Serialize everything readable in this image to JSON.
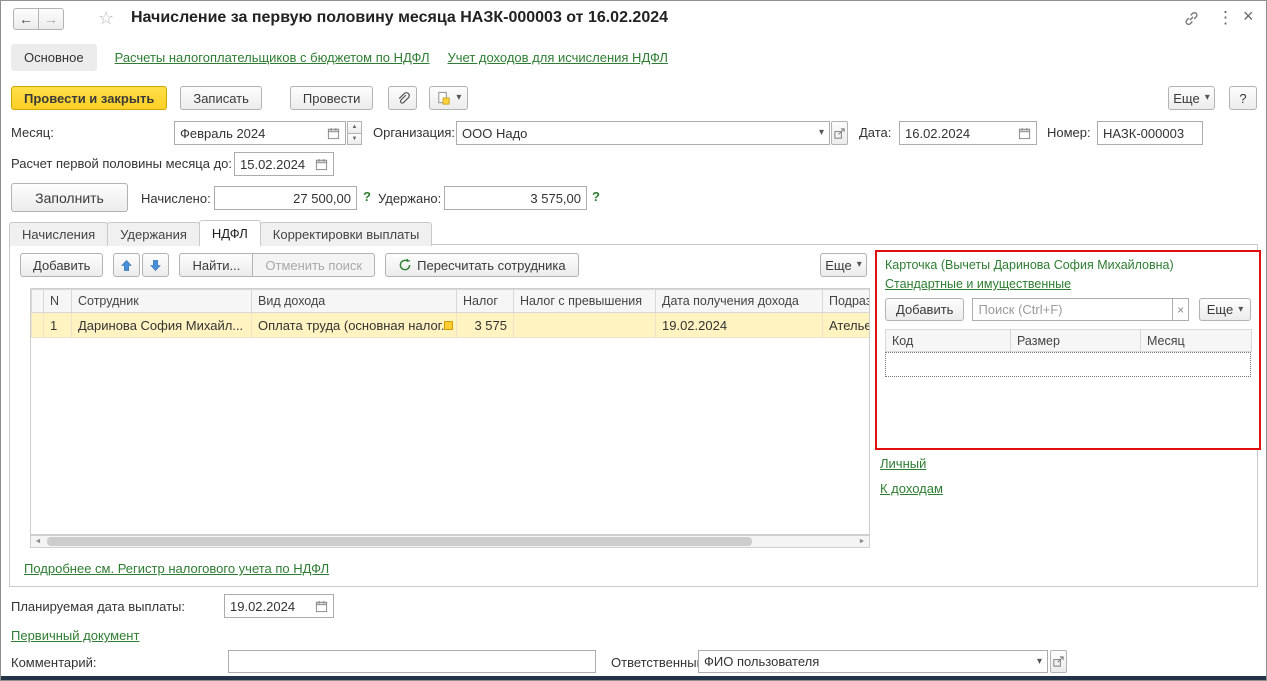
{
  "colors": {
    "accent_yellow": "#fccf25",
    "link_green": "#2e7d32",
    "row_highlight": "#fff3c2",
    "selected_cell": "#ffe6a0",
    "card_border_red": "#e01010"
  },
  "icons": {
    "back": "←",
    "forward": "→",
    "star": "☆",
    "menu": "⋮",
    "close": "×",
    "caret": "▾",
    "spin_up": "▲",
    "spin_down": "▼",
    "clear": "×",
    "hint": "?",
    "scroll_left": "◄",
    "scroll_right": "►"
  },
  "titlebar": {
    "title": "Начисление за первую половину месяца НАЗК-000003 от 16.02.2024"
  },
  "nav": {
    "main": "Основное",
    "links": [
      "Расчеты налогоплательщиков с бюджетом по НДФЛ",
      "Учет доходов для исчисления НДФЛ"
    ]
  },
  "toolbar": {
    "post_and_close": "Провести и закрыть",
    "write": "Записать",
    "post": "Провести",
    "more": "Еще",
    "help": "?"
  },
  "header_fields": {
    "month_label": "Месяц:",
    "month_value": "Февраль 2024",
    "org_label": "Организация:",
    "org_value": "ООО Надо",
    "date_label": "Дата:",
    "date_value": "16.02.2024",
    "number_label": "Номер:",
    "number_value": "НАЗК-000003",
    "calc_until_label": "Расчет первой половины месяца до:",
    "calc_until_value": "15.02.2024",
    "fill_button": "Заполнить",
    "accrued_label": "Начислено:",
    "accrued_value": "27 500,00",
    "withheld_label": "Удержано:",
    "withheld_value": "3 575,00"
  },
  "tabs": {
    "items": [
      "Начисления",
      "Удержания",
      "НДФЛ",
      "Корректировки выплаты"
    ],
    "active": "НДФЛ"
  },
  "grid_toolbar": {
    "add": "Добавить",
    "find": "Найти...",
    "cancel_find": "Отменить поиск",
    "recalc": "Пересчитать сотрудника",
    "more": "Еще"
  },
  "grid": {
    "columns": [
      "N",
      "Сотрудник",
      "Вид дохода",
      "Налог",
      "Налог с превышения",
      "Дата получения дохода",
      "Подраздел"
    ],
    "rows": [
      [
        "1",
        "Даринова София Михайл...",
        "Оплата труда (основная налог...",
        "3 575",
        "",
        "19.02.2024",
        "Ателье"
      ]
    ]
  },
  "card": {
    "title": "Карточка (Вычеты Даринова София Михайловна)",
    "tab_link": "Стандартные и имущественные",
    "add": "Добавить",
    "search_placeholder": "Поиск (Ctrl+F)",
    "more": "Еще",
    "columns": [
      "Код",
      "Размер",
      "Месяц"
    ]
  },
  "links": {
    "register": "Подробнее см. Регистр налогового учета по НДФЛ",
    "personal": "Личный",
    "to_income": "К доходам",
    "primary_document": "Первичный документ"
  },
  "footer": {
    "planned_date_label": "Планируемая дата выплаты:",
    "planned_date_value": "19.02.2024",
    "comment_label": "Комментарий:",
    "comment_value": "",
    "responsible_label": "Ответственный:",
    "responsible_value": "ФИО пользователя"
  }
}
